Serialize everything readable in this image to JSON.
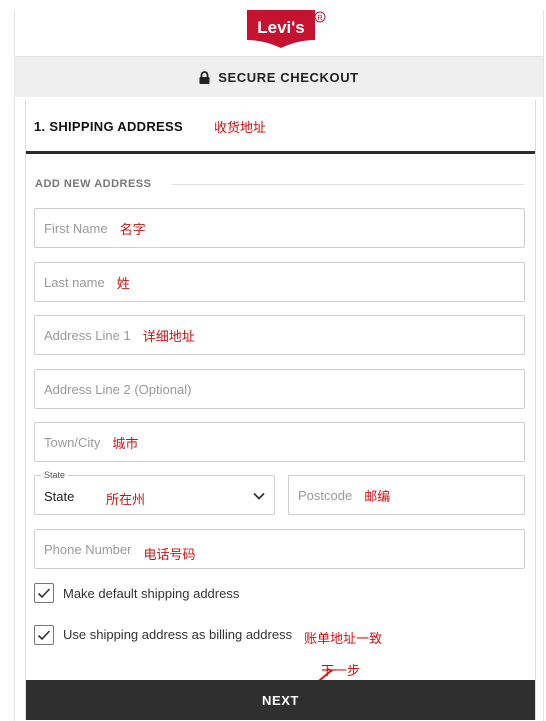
{
  "brand": {
    "logo_text": "Levi's",
    "registered": "®",
    "red": "#c41230"
  },
  "header": {
    "secure_text": "SECURE CHECKOUT"
  },
  "step": {
    "title": "1. SHIPPING ADDRESS",
    "annotation": "收货地址"
  },
  "section": {
    "label": "ADD NEW ADDRESS"
  },
  "fields": {
    "first_name": {
      "placeholder": "First Name",
      "annotation": "名字"
    },
    "last_name": {
      "placeholder": "Last name",
      "annotation": "姓"
    },
    "address1": {
      "placeholder": "Address Line 1",
      "annotation": "详细地址"
    },
    "address2": {
      "placeholder": "Address Line 2 (Optional)"
    },
    "city": {
      "placeholder": "Town/City",
      "annotation": "城市"
    },
    "state": {
      "legend": "State",
      "value": "State",
      "annotation": "所在州"
    },
    "postcode": {
      "placeholder": "Postcode",
      "annotation": "邮编"
    },
    "phone": {
      "placeholder": "Phone Number",
      "annotation": "电话号码"
    }
  },
  "checkboxes": {
    "default_shipping": {
      "label": "Make default shipping address",
      "checked": true
    },
    "billing_same": {
      "label": "Use shipping address as billing address",
      "checked": true,
      "annotation": "账单地址一致"
    }
  },
  "actions": {
    "next_label": "NEXT",
    "next_annotation": "下一步"
  },
  "colors": {
    "annotation": "#d40f0f",
    "button": "#2f2f2f",
    "secure_bar": "#efefef"
  }
}
